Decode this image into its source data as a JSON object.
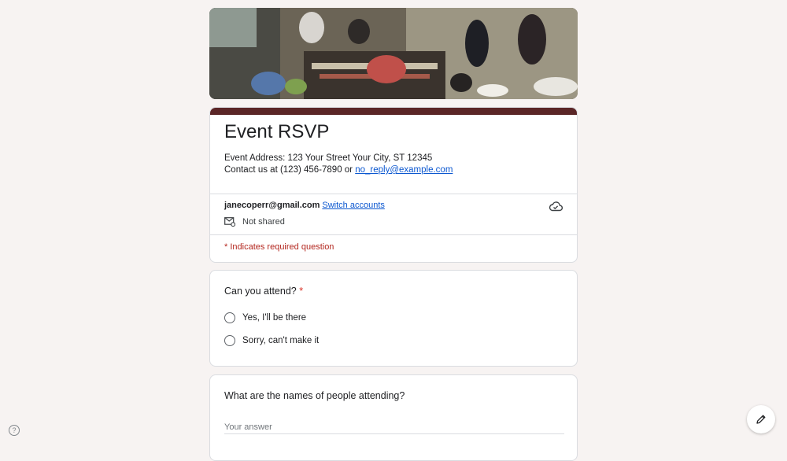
{
  "form": {
    "title": "Event RSVP",
    "address": "Event Address: 123 Your Street Your City, ST 12345",
    "contact_prefix": "Contact us at (123) 456-7890 or ",
    "contact_email": "no_reply@example.com",
    "account_email": "janecoperr@gmail.com",
    "switch_accounts": "Switch accounts",
    "not_shared": "Not shared",
    "required_note": "* Indicates required question",
    "theme_color": "#5b2627"
  },
  "questions": [
    {
      "title": "Can you attend?",
      "required_mark": "*",
      "options": [
        "Yes,  I'll be there",
        "Sorry, can't make it"
      ]
    },
    {
      "title": "What are the names of people attending?",
      "placeholder": "Your answer"
    }
  ],
  "icons": {
    "cloud": "cloud-check-icon",
    "share": "envelope-settings-icon",
    "help": "help-icon",
    "edit": "pencil-icon"
  },
  "help_glyph": "?"
}
